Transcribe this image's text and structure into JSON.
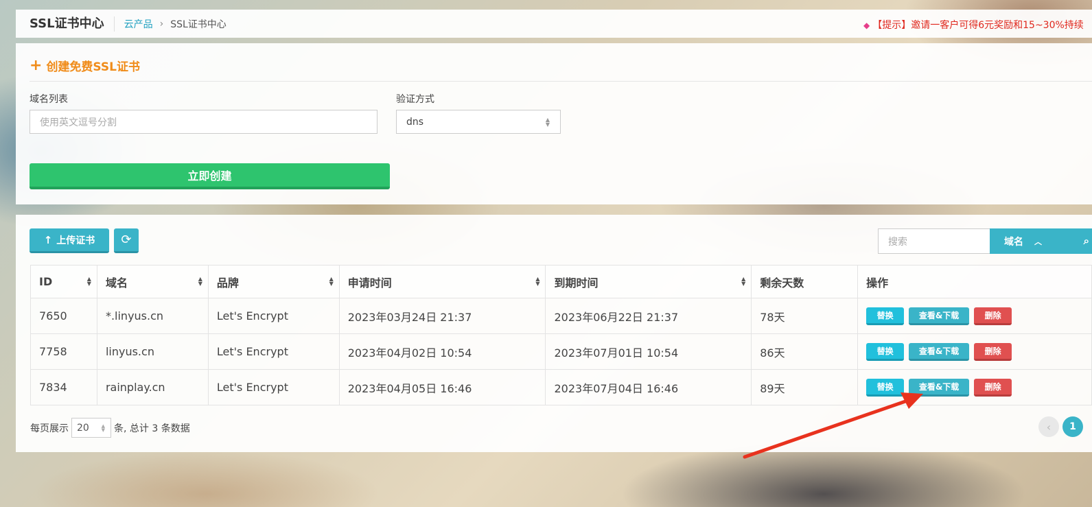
{
  "header": {
    "title": "SSL证书中心",
    "breadcrumb": {
      "parent": "云产品",
      "separator": "›",
      "current": "SSL证书中心"
    },
    "notice": "【提示】邀请一客户可得6元奖励和15~30%持续"
  },
  "create_form": {
    "heading": "创建免费SSL证书",
    "domain_label": "域名列表",
    "domain_placeholder": "使用英文逗号分割",
    "verify_label": "验证方式",
    "verify_value": "dns",
    "submit": "立即创建"
  },
  "toolbar": {
    "upload": "上传证书",
    "search_placeholder": "搜索",
    "search_field": "域名"
  },
  "table": {
    "columns": [
      "ID",
      "域名",
      "品牌",
      "申请时间",
      "到期时间",
      "剩余天数",
      "操作"
    ],
    "rows": [
      {
        "id": "7650",
        "domain": "*.linyus.cn",
        "brand": "Let's Encrypt",
        "applied": "2023年03月24日 21:37",
        "expires": "2023年06月22日 21:37",
        "remaining": "78天"
      },
      {
        "id": "7758",
        "domain": "linyus.cn",
        "brand": "Let's Encrypt",
        "applied": "2023年04月02日 10:54",
        "expires": "2023年07月01日 10:54",
        "remaining": "86天"
      },
      {
        "id": "7834",
        "domain": "rainplay.cn",
        "brand": "Let's Encrypt",
        "applied": "2023年04月05日 16:46",
        "expires": "2023年07月04日 16:46",
        "remaining": "89天"
      }
    ],
    "actions": {
      "replace": "替换",
      "view_download": "查看&下载",
      "delete": "删除"
    }
  },
  "pagination": {
    "per_page_label": "每页展示",
    "per_page_value": "20",
    "summary": "条, 总计 3 条数据",
    "current_page": "1"
  },
  "colors": {
    "accent": "#3ab4c8",
    "create_button": "#2ec46e",
    "delete_button": "#e05050",
    "heading_orange": "#f08c1a",
    "annotation_arrow": "#e8321e"
  }
}
